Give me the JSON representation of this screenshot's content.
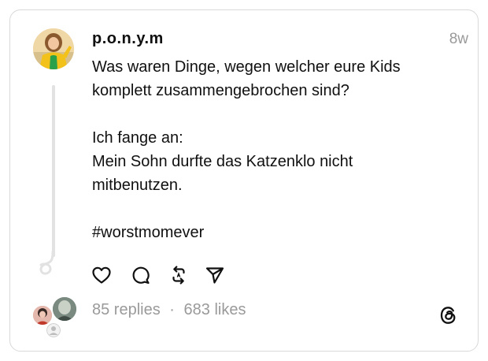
{
  "post": {
    "username": "p.o.n.y.m",
    "timestamp": "8w",
    "lines": [
      "Was waren Dinge, wegen welcher eure Kids",
      "komplett zusammengebrochen sind?",
      "",
      "Ich fange an:",
      "Mein Sohn durfte das Katzenklo nicht",
      "mitbenutzen.",
      "",
      "#worstmomever"
    ]
  },
  "actions": {
    "icons": [
      "heart-icon",
      "comment-icon",
      "repost-icon",
      "share-icon"
    ]
  },
  "footer": {
    "replies": "85 replies",
    "separator": "·",
    "likes": "683 likes"
  },
  "colors": {
    "text": "#101010",
    "muted": "#9a9a9a",
    "border": "#d9d9d9",
    "thread_line": "#e2e2e2"
  }
}
